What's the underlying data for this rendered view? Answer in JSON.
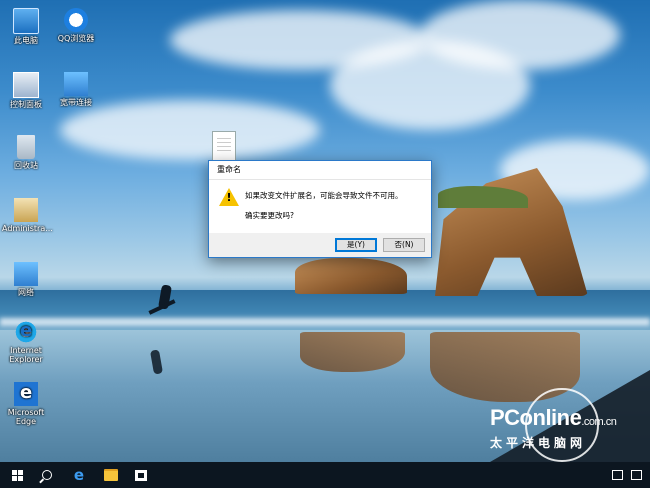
{
  "desktop": {
    "icons": [
      {
        "id": "this-pc",
        "label": "此电脑"
      },
      {
        "id": "qq-browser",
        "label": "QQ浏览器"
      },
      {
        "id": "control-panel",
        "label": "控制面板"
      },
      {
        "id": "network-map",
        "label": "宽带连接"
      },
      {
        "id": "recycle-bin",
        "label": "回收站"
      },
      {
        "id": "administrator",
        "label": "Administra..."
      },
      {
        "id": "network",
        "label": "网络"
      },
      {
        "id": "internet-explorer",
        "label": "Internet Explorer"
      },
      {
        "id": "microsoft-edge",
        "label": "Microsoft Edge"
      }
    ]
  },
  "dialog": {
    "title": "重命名",
    "message": "如果改变文件扩展名，可能会导致文件不可用。",
    "question": "确实要更改吗?",
    "yes_label": "是(Y)",
    "no_label": "否(N)"
  },
  "watermark": {
    "brand": "PConline",
    "brand_suffix": ".com.cn",
    "subtitle": "太平洋电脑网"
  },
  "taskbar": {
    "icons": [
      "windows-start-icon",
      "search-icon",
      "edge-icon",
      "file-explorer-icon",
      "store-icon"
    ]
  },
  "colors": {
    "accent": "#0078d7",
    "dialog_border": "#2b79c9",
    "warning": "#f6c200",
    "taskbar": "#0c1620"
  }
}
